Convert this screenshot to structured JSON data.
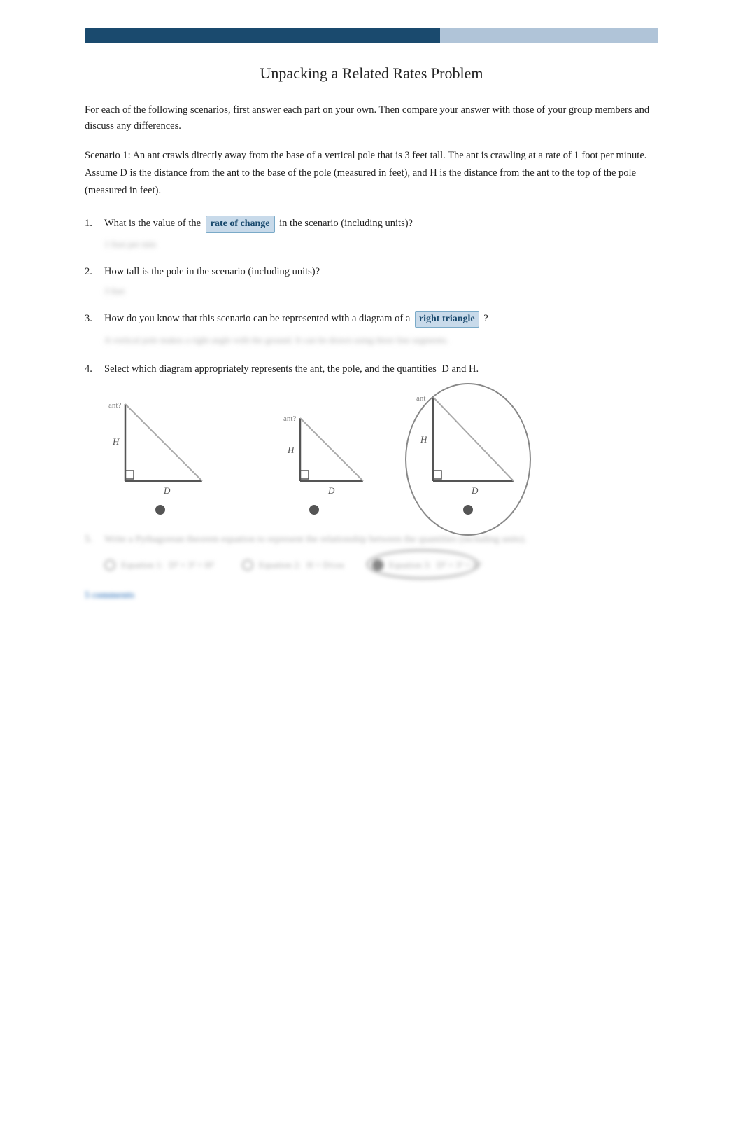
{
  "progressBar": {
    "fillPercent": 62
  },
  "title": "Unpacking a Related Rates Problem",
  "intro": {
    "text": "For each of the following scenarios, first answer each part on your own. Then compare your answer with those of your group members and discuss any differences."
  },
  "scenario": {
    "text1": "Scenario 1:    An ant crawls directly away from the base of a vertical pole that is 3 feet tall. The ant is crawling at a rate of 1 foot per minute. Assume",
    "D_label": "D is the distance from the ant to the base of the pole (measured in feet), and",
    "H_label": "H is the distance from the ant to the top of the pole (measured in feet)."
  },
  "questions": [
    {
      "number": "1.",
      "prefix": "What is the value of the",
      "highlight": "rate of change",
      "suffix": "in the scenario (including units)?",
      "answer_blur": "1 foot per min"
    },
    {
      "number": "2.",
      "prefix": "How tall is the pole",
      "suffix": "in the scenario (including units)?",
      "answer_blur": "3 feet"
    },
    {
      "number": "3.",
      "prefix": "How do you know that this scenario can be represented with a diagram of a",
      "highlight": "right triangle",
      "suffix": "?",
      "answer_blur_wide": "A vertical pole makes a right angle with the ground. It can be drawn using three line segments."
    },
    {
      "number": "4.",
      "text": "Select which diagram appropriately represents the ant, the pole, and the quantities",
      "D_and_H": "D and  H."
    }
  ],
  "q5": {
    "blur_text": "Write a Pythagorean theorem equation to represent the relationship between the quantities (including units).",
    "options": [
      {
        "label": "Equation 1:",
        "value": "D² + 3² = H²",
        "selected": false
      },
      {
        "label": "Equation 2:",
        "value": "H = D/cos",
        "selected": false
      },
      {
        "label": "Equation 3:",
        "value": "D² + 3² = H²",
        "selected": true
      }
    ]
  },
  "footer_blur": "5 comments",
  "diagrams": [
    {
      "id": "A",
      "selected": false
    },
    {
      "id": "B",
      "selected": false
    },
    {
      "id": "C",
      "selected": true
    }
  ]
}
